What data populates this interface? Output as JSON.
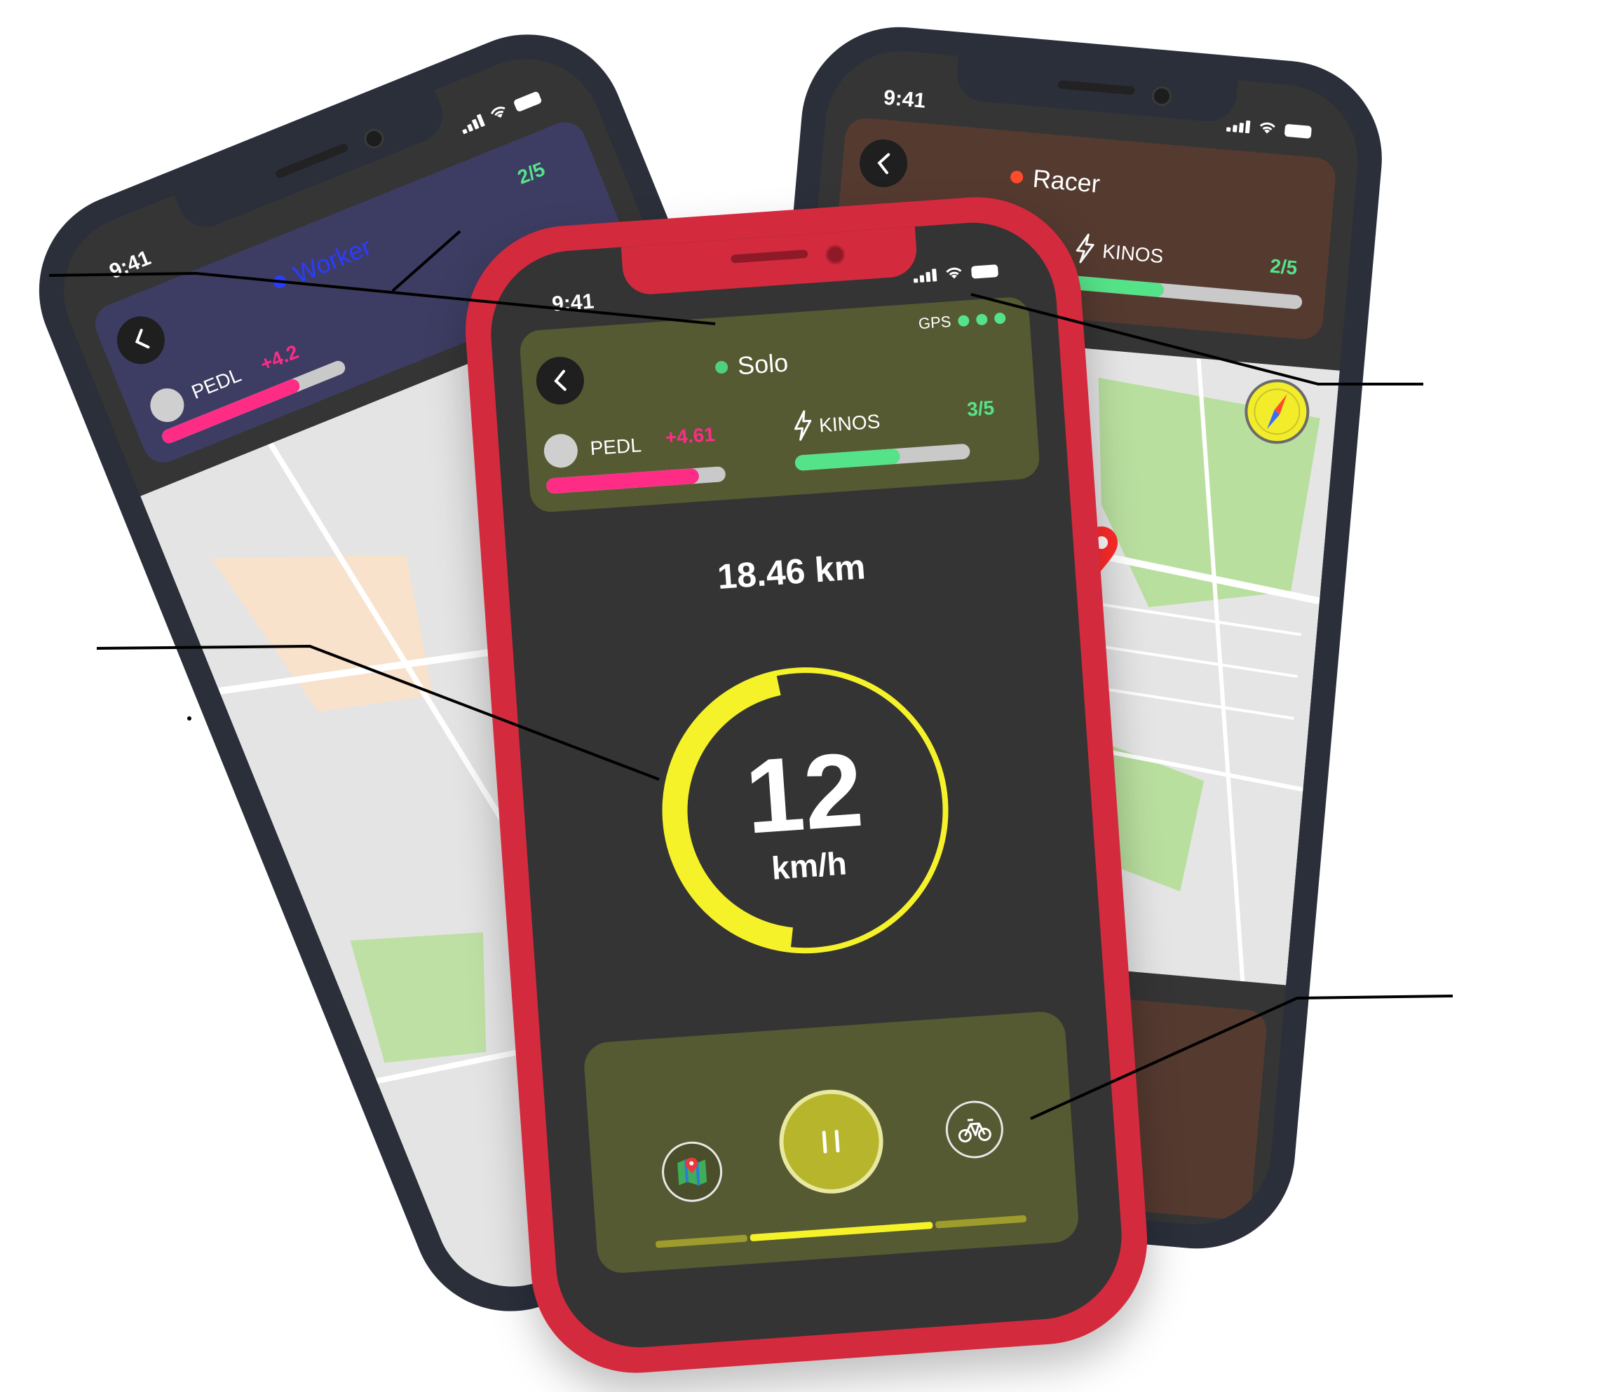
{
  "status": {
    "time": "9:41"
  },
  "left_phone": {
    "mode_label": "Worker",
    "mode_color": "#2a3cff",
    "counter_label": "2/5",
    "pedl_label": "PEDL",
    "pedl_delta": "+4.2",
    "pedl_fill": 0.75
  },
  "right_phone": {
    "mode_label": "Racer",
    "mode_color": "#ff4b2b",
    "kinos_label": "KINOS",
    "kinos_value": "2/5",
    "kinos_fill": 0.4
  },
  "main_phone": {
    "mode_label": "Solo",
    "mode_color": "#4fd17b",
    "gps_label": "GPS",
    "gps_dots": 3,
    "pedl_label": "PEDL",
    "pedl_delta": "+4.61",
    "pedl_fill": 0.85,
    "kinos_label": "KINOS",
    "kinos_value": "3/5",
    "kinos_fill": 0.6,
    "distance": "18.46 km",
    "speed_value": "12",
    "speed_unit": "km/h",
    "speed_progress": 0.45,
    "controls": {
      "map_button_icon": "map-icon",
      "pause_button_icon": "pause-icon",
      "bike_button_icon": "bike-icon"
    },
    "page_indicator": {
      "pages": 3,
      "active": 1
    }
  },
  "colors": {
    "main_frame": "#d42a3e",
    "back_frame": "#2a2f3a",
    "main_header": "#565a32",
    "right_header": "#553a30",
    "left_header": "#3d3d63",
    "speed_ring": "#f6f22a",
    "pedl_bar": "#ff2c86",
    "kinos_bar": "#55e389",
    "positive_green": "#55e389",
    "pedl_delta": "#ff2c86"
  }
}
